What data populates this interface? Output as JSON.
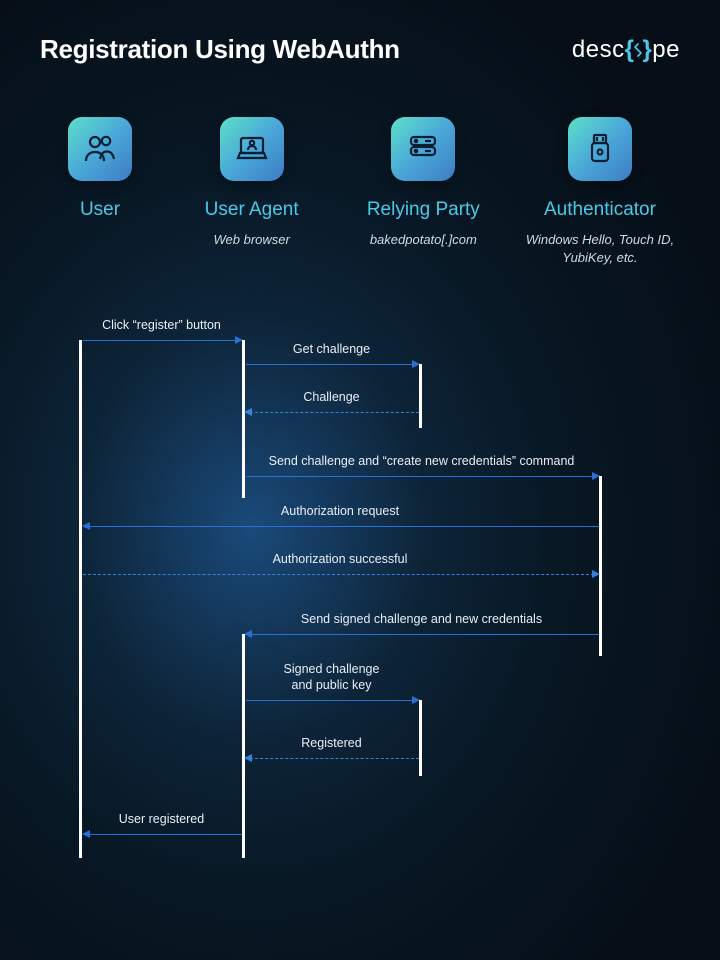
{
  "title": "Registration Using WebAuthn",
  "brand": {
    "pre": "desc",
    "post": "pe"
  },
  "actors": {
    "user": {
      "label": "User",
      "sub": ""
    },
    "agent": {
      "label": "User Agent",
      "sub": "Web browser"
    },
    "rp": {
      "label": "Relying Party",
      "sub": "bakedpotato[.]com"
    },
    "auth": {
      "label": "Authenticator",
      "sub": "Windows Hello, Touch ID, YubiKey, etc."
    }
  },
  "messages": {
    "m1": "Click “register” button",
    "m2": "Get challenge",
    "m3": "Challenge",
    "m4": "Send challenge and “create new credentials” command",
    "m5": "Authorization request",
    "m6": "Authorization successful",
    "m7": "Send signed challenge and new credentials",
    "m8a": "Signed challenge",
    "m8b": "and public key",
    "m9": "Registered",
    "m10": "User registered"
  }
}
